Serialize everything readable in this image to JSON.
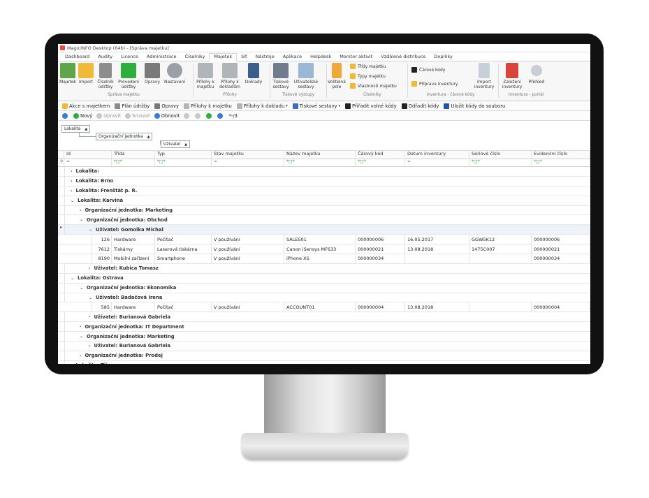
{
  "window": {
    "title": "MagicINFO Desktop (64b) - [Správa majetku]"
  },
  "menu": [
    "Dashboard",
    "Audity",
    "Licence",
    "Administrace",
    "Číselníky",
    "Majetek",
    "Síť",
    "Nástroje",
    "Aplikace",
    "Helpdesk",
    "Monitor aktivit",
    "Vzdálené distribuce",
    "Doplňky"
  ],
  "menu_active": "Majetek",
  "ribbon": {
    "buttons": [
      "Majetek",
      "Import",
      "Číselník údržby",
      "Provedení údržby",
      "Opravy",
      "Nastavení",
      "Přílohy k majetku",
      "Přílohy k dokladům",
      "Doklady",
      "Tiskové sestavy",
      "Uživatelské sestavy",
      "Volitelná pole",
      "Čárové kódy",
      "Import inventury",
      "Založení inventury",
      "Přehled"
    ],
    "small": [
      "Třídy majetku",
      "Typy majetku",
      "Vlastnosti majetku",
      "Příprava inventury"
    ],
    "groups": [
      "Správa majetku",
      "Přílohy",
      "Tiskové výstupy",
      "Číselníky",
      "Inventura - čárové kódy",
      "Inventura - portál"
    ]
  },
  "toolbar1": [
    "Akce s majetkem",
    "Plán údržby",
    "Opravy",
    "Přílohy k majetku",
    "Přílohy k dokladu",
    "Tiskové sestavy",
    "Přiřadit volné kódy",
    "Odřadit kódy",
    "Uložit kódy do souboru"
  ],
  "toolbar2": [
    "Nový",
    "Upravit",
    "Smazat",
    "Obnovit",
    "*-/3"
  ],
  "grouping": {
    "chips": [
      "Lokalita",
      "Organizační jednotka",
      "Uživatel"
    ]
  },
  "columns": [
    "Id",
    "Třída",
    "Typ",
    "Stav majetku",
    "Název majetku",
    "Čárový kód",
    "Datum inventury",
    "Sériové číslo",
    "Evidenční číslo"
  ],
  "filter": [
    "=",
    "*□*",
    "*□*",
    "=",
    "*□*",
    "*□*",
    "=",
    "*□*",
    "*□*"
  ],
  "rows": [
    {
      "kind": "group",
      "level": 0,
      "open": false,
      "text": "Lokalita:"
    },
    {
      "kind": "group",
      "level": 0,
      "open": false,
      "text": "Lokalita: Brno"
    },
    {
      "kind": "group",
      "level": 0,
      "open": false,
      "text": "Lokalita: Frenštát p. R."
    },
    {
      "kind": "group",
      "level": 0,
      "open": true,
      "text": "Lokalita: Karviná"
    },
    {
      "kind": "group",
      "level": 1,
      "open": false,
      "text": "Organizační jednotka: Marketing"
    },
    {
      "kind": "group",
      "level": 1,
      "open": true,
      "text": "Organizační jednotka: Obchod"
    },
    {
      "kind": "group",
      "level": 2,
      "open": true,
      "text": "Uživatel: Gomolka Michal",
      "selected": true
    },
    {
      "kind": "data",
      "cells": [
        "126",
        "Hardware",
        "Počítač",
        "V používání",
        "SALES01",
        "000000006",
        "16.05.2017",
        "GGW5K12",
        "000000006"
      ]
    },
    {
      "kind": "data",
      "cells": [
        "7612",
        "Tiskárny",
        "Laserová tiskárna",
        "V používání",
        "Canon iSensys MF633",
        "000000021",
        "13.08.2018",
        "1475C007",
        "000000021"
      ]
    },
    {
      "kind": "data",
      "cells": [
        "8190",
        "Mobilní zařízení",
        "Smartphone",
        "V používání",
        "iPhone XS",
        "000000034",
        "",
        "",
        "000000034"
      ]
    },
    {
      "kind": "group",
      "level": 2,
      "open": false,
      "text": "Uživatel: Kubica Tomasz"
    },
    {
      "kind": "group",
      "level": 0,
      "open": true,
      "text": "Lokalita: Ostrava"
    },
    {
      "kind": "group",
      "level": 1,
      "open": true,
      "text": "Organizační jednotka: Ekonomika"
    },
    {
      "kind": "group",
      "level": 2,
      "open": true,
      "text": "Uživatel: Badačová Irena"
    },
    {
      "kind": "data",
      "cells": [
        "585",
        "Hardware",
        "Počítač",
        "V používání",
        "ACCOUNT01",
        "000000004",
        "13.08.2018",
        "",
        "000000004"
      ]
    },
    {
      "kind": "group",
      "level": 2,
      "open": false,
      "text": "Uživatel: Burianová Gabriela"
    },
    {
      "kind": "group",
      "level": 1,
      "open": false,
      "text": "Organizační jednotka: IT Department"
    },
    {
      "kind": "group",
      "level": 1,
      "open": true,
      "text": "Organizační jednotka: Marketing"
    },
    {
      "kind": "group",
      "level": 2,
      "open": false,
      "text": "Uživatel: Burianová Gabriela"
    },
    {
      "kind": "group",
      "level": 1,
      "open": false,
      "text": "Organizační jednotka: Prodej"
    },
    {
      "kind": "group",
      "level": 0,
      "open": false,
      "text": "Lokalita: Třinec"
    }
  ]
}
